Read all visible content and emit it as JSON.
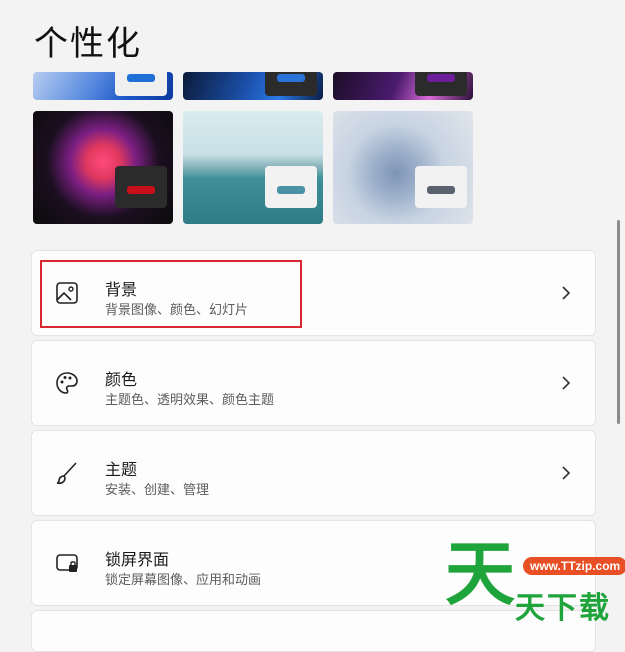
{
  "page_title": "个性化",
  "themes": [
    {
      "name": "theme-blue-bloom",
      "accent": "#1e6fd6"
    },
    {
      "name": "theme-dark-blue-bloom",
      "accent": "#2a73d6"
    },
    {
      "name": "theme-purple",
      "accent": "#6b1d9a"
    },
    {
      "name": "theme-flower",
      "accent": "#c8101a"
    },
    {
      "name": "theme-lake",
      "accent": "#4a93a6"
    },
    {
      "name": "theme-swirl",
      "accent": "#5a6270"
    }
  ],
  "cards": [
    {
      "label": "背景",
      "desc": "背景图像、颜色、幻灯片",
      "icon": "image-icon"
    },
    {
      "label": "颜色",
      "desc": "主题色、透明效果、颜色主题",
      "icon": "palette-icon"
    },
    {
      "label": "主题",
      "desc": "安装、创建、管理",
      "icon": "brush-icon"
    },
    {
      "label": "锁屏界面",
      "desc": "锁定屏幕图像、应用和动画",
      "icon": "lock-screen-icon"
    }
  ],
  "watermark": {
    "glyph": "天",
    "url": "www.TTzip.com",
    "text": "天下载"
  },
  "colors": {
    "highlight": "#d9282f",
    "watermark_green": "#1fa33b",
    "watermark_orange": "#e84f24"
  }
}
